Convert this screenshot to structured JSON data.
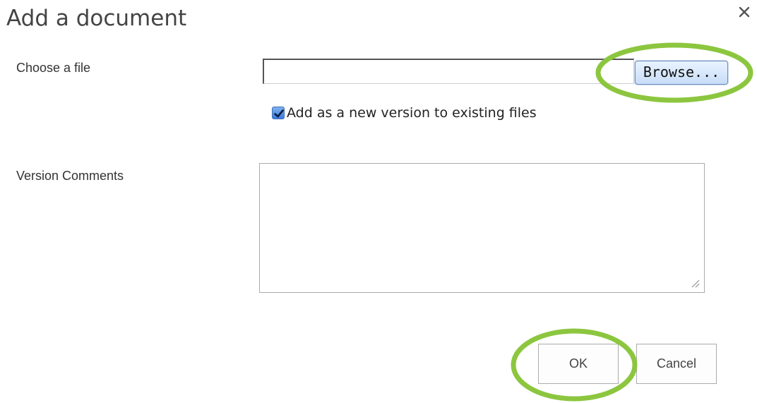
{
  "dialog": {
    "title": "Add a document",
    "close_icon": "close-icon"
  },
  "file_section": {
    "label": "Choose a file",
    "input_value": "",
    "browse_label": "Browse..."
  },
  "version_option": {
    "checked": true,
    "label": "Add as a new version to existing files"
  },
  "comments_section": {
    "label": "Version Comments",
    "value": ""
  },
  "actions": {
    "ok_label": "OK",
    "cancel_label": "Cancel"
  },
  "annotations": {
    "highlight_color": "#8cc63f",
    "checkbox_color": "#3a7ae0"
  }
}
